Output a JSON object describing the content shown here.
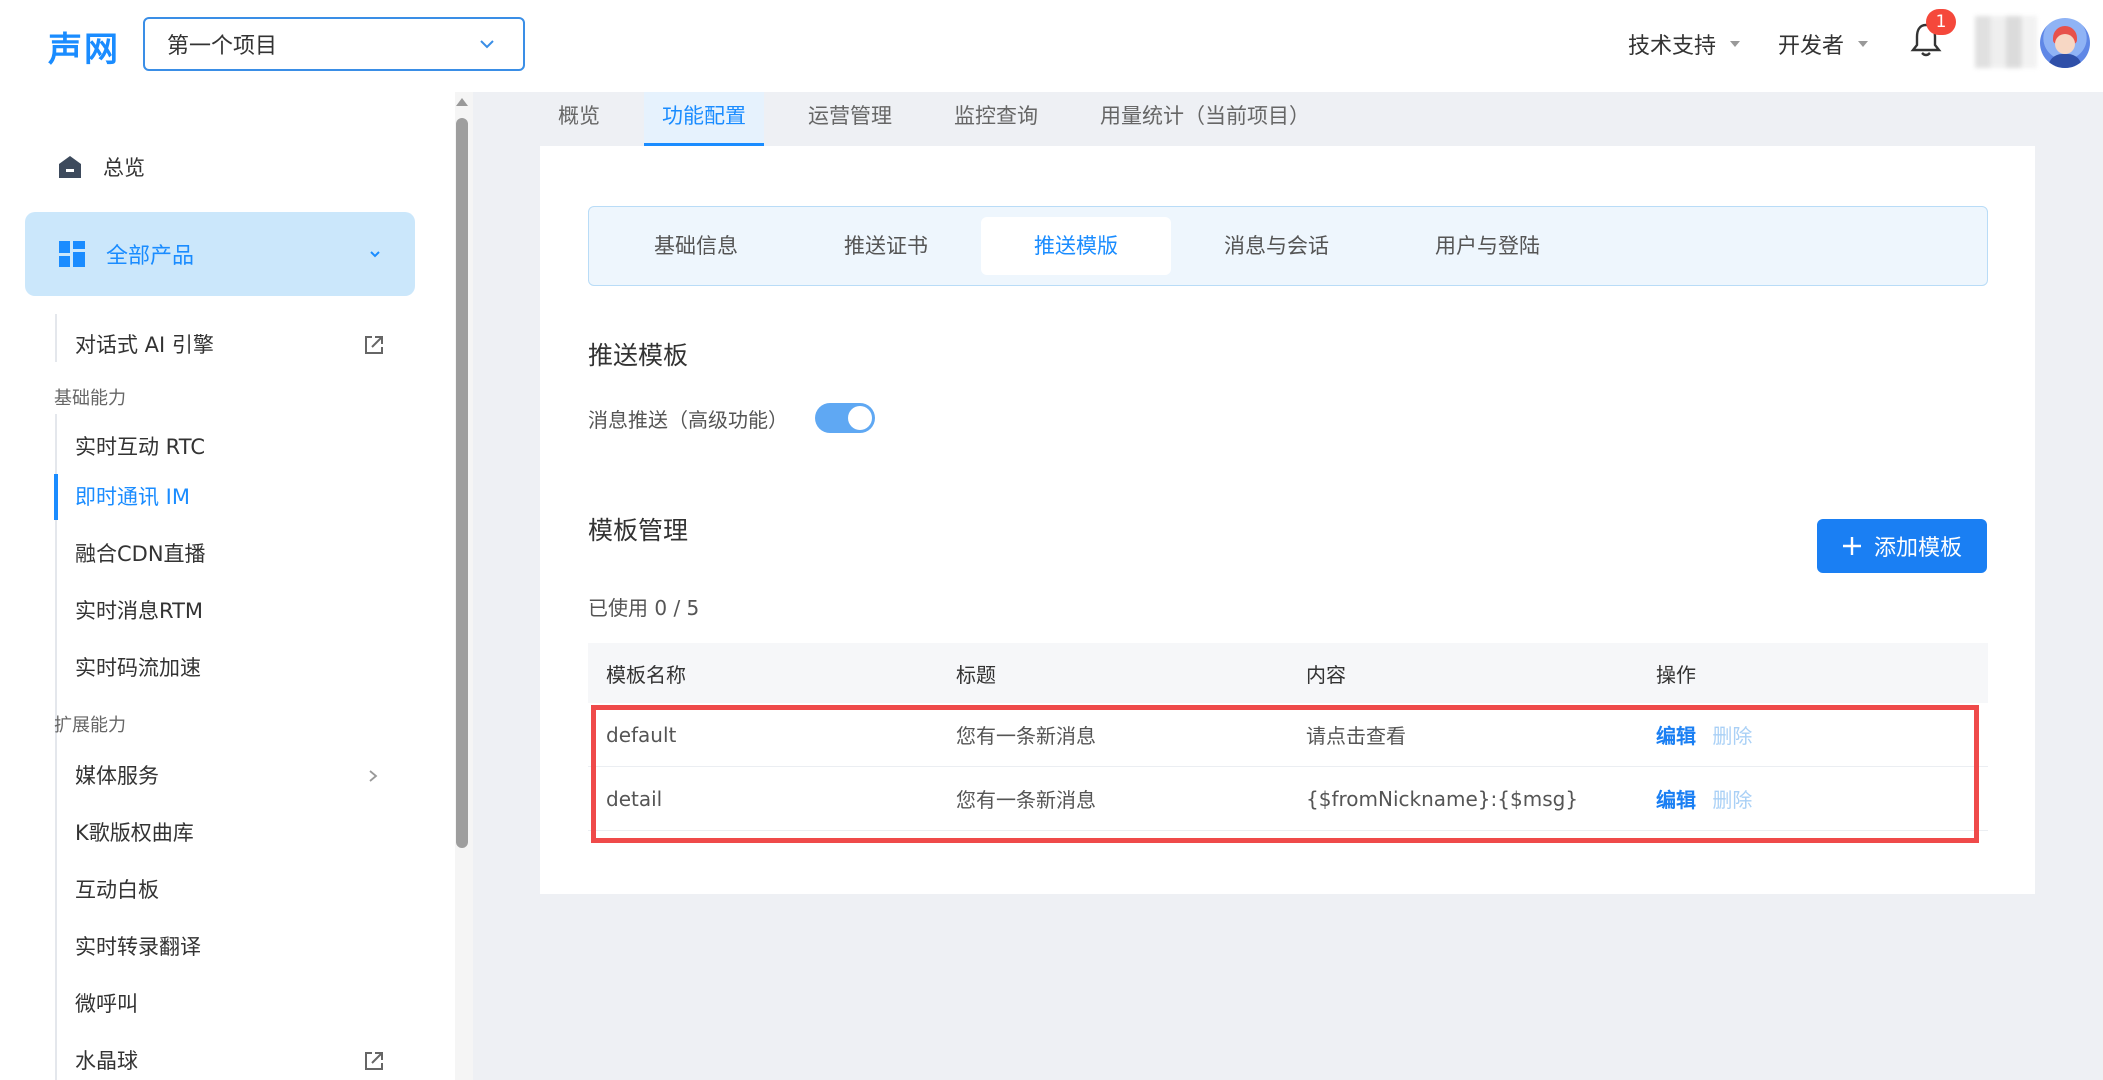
{
  "header": {
    "logo": "声网",
    "project_select": "第一个项目",
    "support_menu": "技术支持",
    "developer_menu": "开发者",
    "notification_count": "1"
  },
  "sidebar": {
    "overview": "总览",
    "all_products": "全部产品",
    "conversational_ai": "对话式 AI 引擎",
    "group_basic": "基础能力",
    "basic_items": [
      "实时互动 RTC",
      "即时通讯 IM",
      "融合CDN直播",
      "实时消息RTM",
      "实时码流加速"
    ],
    "group_ext": "扩展能力",
    "ext_items": [
      "媒体服务",
      "K歌版权曲库",
      "互动白板",
      "实时转录翻译",
      "微呼叫",
      "水晶球"
    ]
  },
  "top_tabs": [
    "概览",
    "功能配置",
    "运营管理",
    "监控查询",
    "用量统计（当前项目）"
  ],
  "sub_tabs": [
    "基础信息",
    "推送证书",
    "推送模版",
    "消息与会话",
    "用户与登陆"
  ],
  "push": {
    "title": "推送模板",
    "toggle_label": "消息推送（高级功能）",
    "toggle_on": true
  },
  "templates": {
    "title": "模板管理",
    "add_button": "添加模板",
    "usage": "已使用 0 / 5",
    "columns": [
      "模板名称",
      "标题",
      "内容",
      "操作"
    ],
    "rows": [
      {
        "name": "default",
        "title": "您有一条新消息",
        "content": "请点击查看",
        "edit": "编辑",
        "delete": "删除"
      },
      {
        "name": "detail",
        "title": "您有一条新消息",
        "content": "{$fromNickname}:{$msg}",
        "edit": "编辑",
        "delete": "删除"
      }
    ]
  },
  "colors": {
    "accent": "#1a8cff",
    "highlight": "#ef4a4a"
  }
}
